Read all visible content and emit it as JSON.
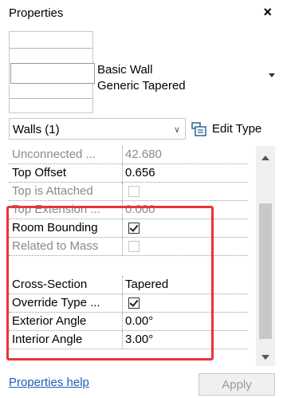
{
  "panel": {
    "title": "Properties",
    "close_glyph": "×"
  },
  "type_selector": {
    "family": "Basic Wall",
    "type": "Generic Tapered"
  },
  "filter": {
    "selected": "Walls (1)",
    "edit_type_label": "Edit Type"
  },
  "properties": [
    {
      "name": "Unconnected ...",
      "value": "42.680",
      "readonly": true
    },
    {
      "name": "Top Offset",
      "value": "0.656",
      "readonly": false
    },
    {
      "name": "Top is Attached",
      "value": "",
      "readonly": true,
      "checkbox": true,
      "checked": false
    },
    {
      "name": "Top Extension ...",
      "value": "0.000",
      "readonly": true
    },
    {
      "name": "Room Bounding",
      "value": "",
      "readonly": false,
      "checkbox": true,
      "checked": true
    },
    {
      "name": "Related to Mass",
      "value": "",
      "readonly": true,
      "checkbox": true,
      "checked": false
    },
    {
      "name": "Cross-Section",
      "value": "Tapered",
      "readonly": false
    },
    {
      "name": "Override Type ...",
      "value": "",
      "readonly": false,
      "checkbox": true,
      "checked": true
    },
    {
      "name": "Exterior Angle",
      "value": "0.00°",
      "readonly": false
    },
    {
      "name": "Interior Angle",
      "value": "3.00°",
      "readonly": false
    }
  ],
  "footer": {
    "help_link": "Properties help",
    "apply_label": "Apply"
  },
  "colors": {
    "highlight": "#e8343a",
    "link": "#1a5fb4"
  }
}
